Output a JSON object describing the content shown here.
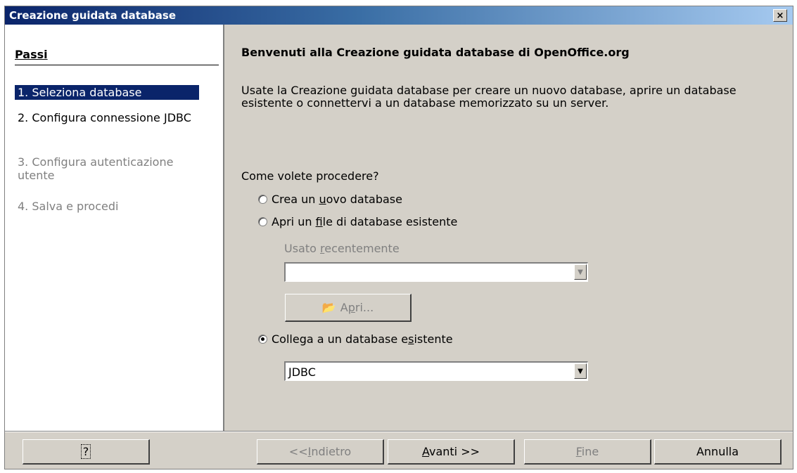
{
  "window": {
    "title": "Creazione guidata database",
    "close_label": "×"
  },
  "steps": {
    "header": "Passi",
    "items": [
      {
        "label": "1. Seleziona database",
        "state": "selected"
      },
      {
        "label": "2. Configura connessione JDBC",
        "state": "normal"
      },
      {
        "label": "3. Configura autenticazione utente",
        "state": "disabled"
      },
      {
        "label": "4. Salva e procedi",
        "state": "disabled"
      }
    ]
  },
  "main": {
    "heading": "Benvenuti alla Creazione guidata database di OpenOffice.org",
    "intro": "Usate la Creazione guidata database per creare un nuovo database, aprire un database esistente o connettervi a un database memorizzato su un server.",
    "question": "Come volete procedere?",
    "options": [
      {
        "pre": "Crea un ",
        "key": "u",
        "post": "ovo database",
        "checked": false
      },
      {
        "pre": "Apri un ",
        "key": "f",
        "post": "ile di database esistente",
        "checked": false
      },
      {
        "pre": "Collega a un database e",
        "key": "s",
        "post": "istente",
        "checked": true
      }
    ],
    "recent": {
      "pre": "Usato ",
      "key": "r",
      "post": "ecentemente",
      "value": ""
    },
    "open_button": {
      "pre": "A",
      "key": "p",
      "post": "ri...",
      "icon": "folder-open-icon"
    },
    "connection_type": {
      "value": "JDBC"
    }
  },
  "footer": {
    "help": "?",
    "back": {
      "pre": "<<",
      "key": "I",
      "post": "ndietro"
    },
    "next": {
      "pre": "",
      "key": "A",
      "post": "vanti >>"
    },
    "finish": {
      "pre": "",
      "key": "F",
      "post": "ine"
    },
    "cancel": "Annulla"
  }
}
